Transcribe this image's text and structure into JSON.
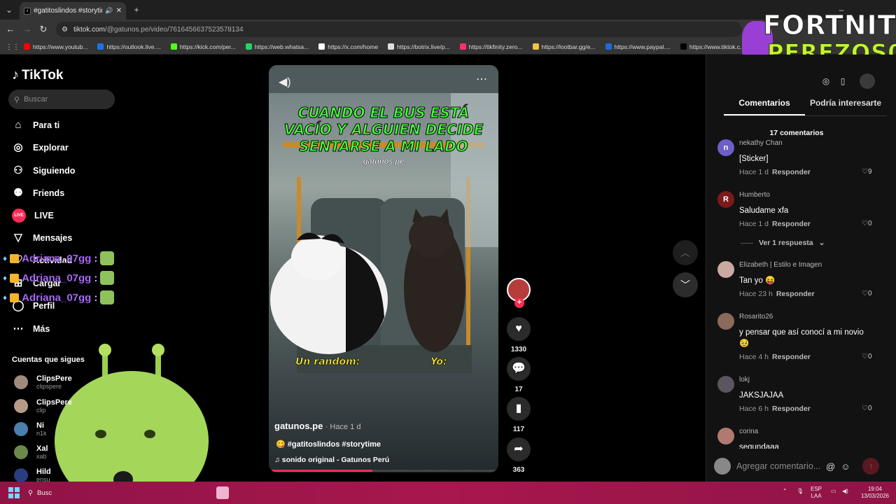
{
  "browser": {
    "tab_title": "#gatitoslindos #storytim",
    "url_host": "tiktok.com",
    "url_path": "/@gatunos.pe/video/7616456637523578134",
    "bookmarks": [
      {
        "label": "https://www.youtub...",
        "color": "#ff0000"
      },
      {
        "label": "https://outlook.live....",
        "color": "#1e73e8"
      },
      {
        "label": "https://kick.com/per...",
        "color": "#53fc18"
      },
      {
        "label": "https://web.whatsa...",
        "color": "#25d366"
      },
      {
        "label": "https://x.com/home",
        "color": "#ffffff"
      },
      {
        "label": "https://botrix.live/p...",
        "color": "#dddddd"
      },
      {
        "label": "https://tikfinity.zero...",
        "color": "#ff2f6d"
      },
      {
        "label": "https://lootbar.gg/e...",
        "color": "#f4c542"
      },
      {
        "label": "https://www.paypal....",
        "color": "#1c6bd4"
      },
      {
        "label": "https://www.tiktok.c...",
        "color": "#000000"
      }
    ]
  },
  "overlay": {
    "logo_line1": "FORTNITE",
    "logo_line2": "PEREZOS01",
    "chat": [
      {
        "user": "Adriana_07gg",
        "sep": ":"
      },
      {
        "user": "Adriana_07gg",
        "sep": ":"
      },
      {
        "user": "Adriana_07gg",
        "sep": ":"
      }
    ]
  },
  "sidebar": {
    "brand": "TikTok",
    "search_placeholder": "Buscar",
    "nav": [
      {
        "label": "Para ti",
        "icon": "home-icon"
      },
      {
        "label": "Explorar",
        "icon": "compass-icon"
      },
      {
        "label": "Siguiendo",
        "icon": "following-icon"
      },
      {
        "label": "Friends",
        "icon": "friends-icon"
      },
      {
        "label": "LIVE",
        "icon": "live-icon"
      },
      {
        "label": "Mensajes",
        "icon": "messages-icon"
      },
      {
        "label": "Actividad",
        "icon": "activity-icon"
      },
      {
        "label": "Cargar",
        "icon": "upload-icon"
      },
      {
        "label": "Perfil",
        "icon": "profile-icon"
      },
      {
        "label": "Más",
        "icon": "more-icon"
      }
    ],
    "following_header": "Cuentas que sigues",
    "following": [
      {
        "name": "ClipsPere",
        "handle": "clipspere"
      },
      {
        "name": "ClipsPere",
        "handle": "clip"
      },
      {
        "name": "Ni",
        "handle": "n1k"
      },
      {
        "name": "Xal",
        "handle": "xab"
      },
      {
        "name": "Hild",
        "handle": "ensu"
      }
    ],
    "live_badge": "LIVE"
  },
  "video": {
    "overlay_title": "CUANDO EL BUS ESTÁ VACÍO Y ALGUIEN DECIDE SENTARSE A MI LADO",
    "watermark": "gatunos.pe",
    "caption_left": "Un random:",
    "caption_right": "Yo:",
    "author": "gatunos.pe",
    "time": "Hace 1 d",
    "hashtags": "#gatitoslindos #storytime",
    "sound": "sonido original - Gatunos Perú",
    "progress": 0.45
  },
  "actions": {
    "likes": "1330",
    "comments": "17",
    "saves": "117",
    "shares": "363"
  },
  "comments_panel": {
    "tab_comments": "Comentarios",
    "tab_interest": "Podría interesarte",
    "count_label": "17 comentarios",
    "reply_label": "Responder",
    "view_replies": "Ver 1 respuesta",
    "comments": [
      {
        "user": "nekathy Chan",
        "text": "[Sticker]",
        "time": "Hace 1 d",
        "likes": "9",
        "avatar": "#6c5fc7",
        "initial": "n"
      },
      {
        "user": "Humberto",
        "text": "Saludame xfa",
        "time": "Hace 1 d",
        "likes": "0",
        "avatar": "#7b1a1a",
        "initial": "R"
      },
      {
        "user": "Elizabeth | Estilo e Imagen",
        "text": "Tan yo 😝",
        "time": "Hace 23 h",
        "likes": "0",
        "avatar": "#c9a9a0",
        "initial": ""
      },
      {
        "user": "Rosarito26",
        "text": "y pensar que así conocí a mi novio 🥹",
        "time": "Hace 4 h",
        "likes": "0",
        "avatar": "#8a6a5a",
        "initial": ""
      },
      {
        "user": "lokj",
        "text": "JAKSJAJAA",
        "time": "Hace 6 h",
        "likes": "0",
        "avatar": "#5a5560",
        "initial": ""
      },
      {
        "user": "corina",
        "text": "segundaaa",
        "time": "",
        "likes": "",
        "avatar": "#b07a70",
        "initial": ""
      }
    ],
    "composer_placeholder": "Agregar comentario..."
  },
  "taskbar": {
    "search": "Busc",
    "lang": "ESP",
    "lang2": "LAA",
    "time": "19:04",
    "date": "13/03/2026"
  }
}
